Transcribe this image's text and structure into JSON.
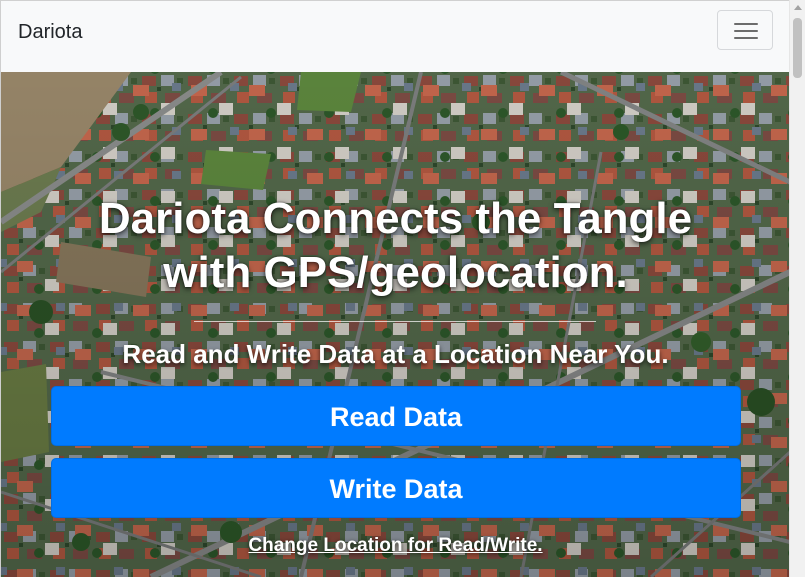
{
  "navbar": {
    "brand": "Dariota",
    "toggler_icon": "hamburger-menu-icon"
  },
  "hero": {
    "title": "Dariota Connects the Tangle with GPS/geolocation.",
    "subtitle": "Read and Write Data at a Location Near You.",
    "read_button": "Read Data",
    "write_button": "Write Data",
    "change_location_link": "Change Location for Read/Write.",
    "background": "aerial-neighborhood-photo"
  },
  "colors": {
    "primary_button": "#007bff",
    "navbar_bg": "#f8f9fa",
    "brand_text": "#212529",
    "hero_text": "#ffffff"
  }
}
